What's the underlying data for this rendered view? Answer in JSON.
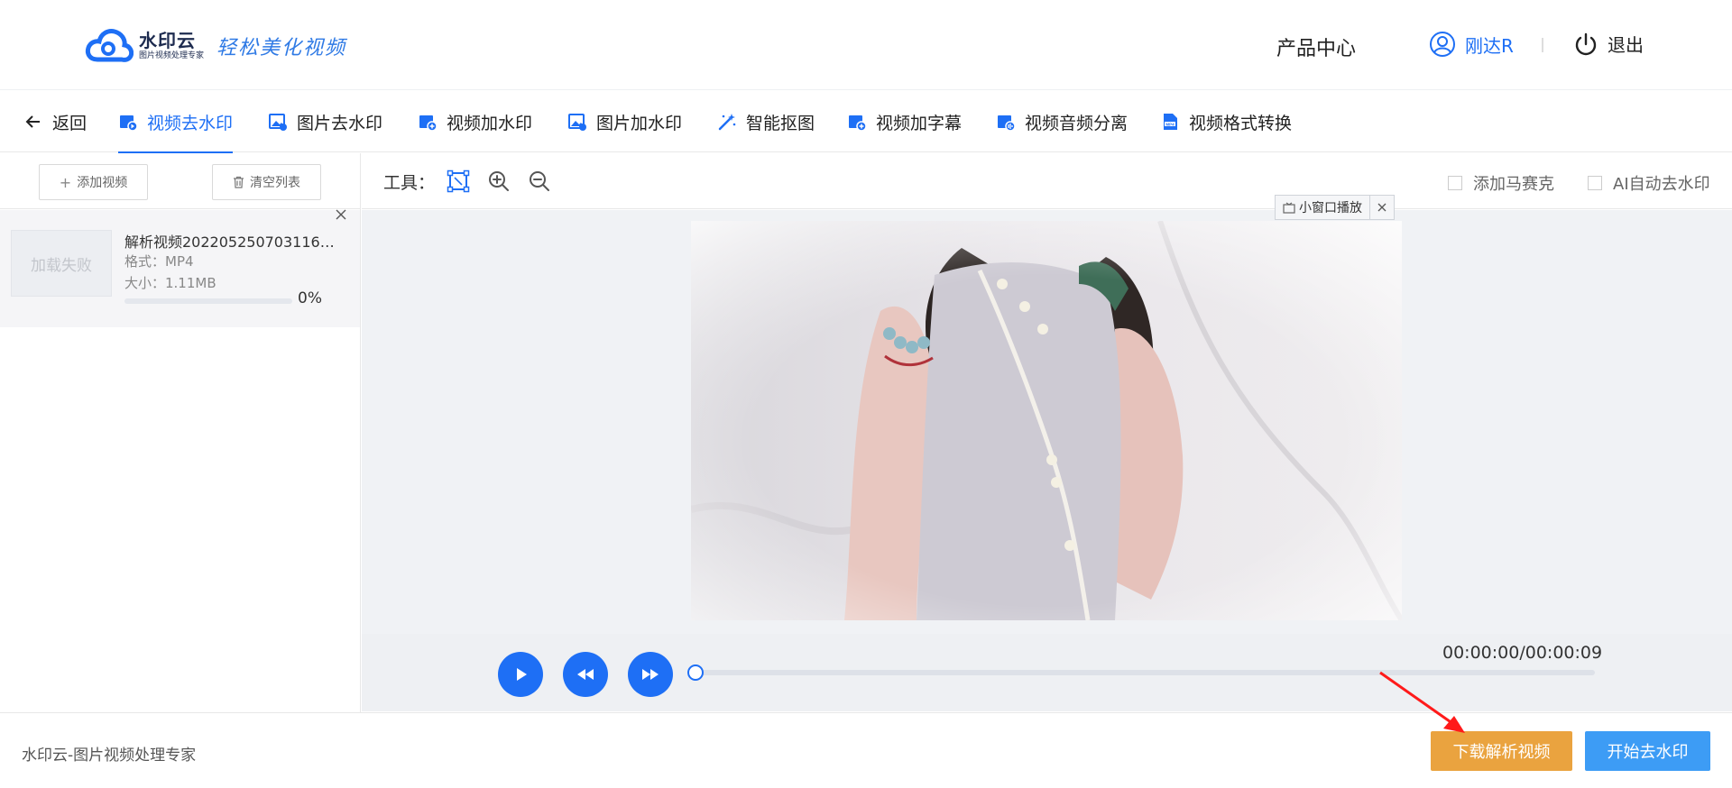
{
  "header": {
    "logo_name": "水印云",
    "logo_sub": "图片视频处理专家",
    "slogan": "轻松美化视频",
    "product_center": "产品中心",
    "username": "刚达R",
    "logout": "退出"
  },
  "nav": {
    "back": "返回",
    "items": [
      {
        "label": "视频去水印",
        "icon": "video-icon",
        "active": true
      },
      {
        "label": "图片去水印",
        "icon": "image-icon"
      },
      {
        "label": "视频加水印",
        "icon": "video-icon"
      },
      {
        "label": "图片加水印",
        "icon": "image-icon"
      },
      {
        "label": "智能抠图",
        "icon": "magic-wand-icon"
      },
      {
        "label": "视频加字幕",
        "icon": "video-icon"
      },
      {
        "label": "视频音频分离",
        "icon": "video-icon"
      },
      {
        "label": "视频格式转换",
        "icon": "mp4-file-icon"
      }
    ]
  },
  "sidebar": {
    "add_video": "添加视频",
    "clear_list": "清空列表",
    "file": {
      "thumb_status": "加载失败",
      "name": "解析视频20220525070311659...",
      "format": "格式：MP4",
      "size": "大小：1.11MB",
      "progress": 0,
      "progress_text": "0%"
    }
  },
  "workspace": {
    "tools_label": "工具：",
    "mosaic": "添加马赛克",
    "ai_remove": "AI自动去水印",
    "mini_window": "小窗口播放",
    "time": "00:00:00/00:00:09",
    "seek_progress": 0
  },
  "footer": {
    "brand": "水印云-图片视频处理专家",
    "download": "下载解析视频",
    "start": "开始去水印"
  },
  "colors": {
    "accent": "#1e6ff5",
    "download_btn": "#eaa33f",
    "start_btn": "#3d9cf5",
    "annotation_arrow": "#ff1a1a"
  }
}
